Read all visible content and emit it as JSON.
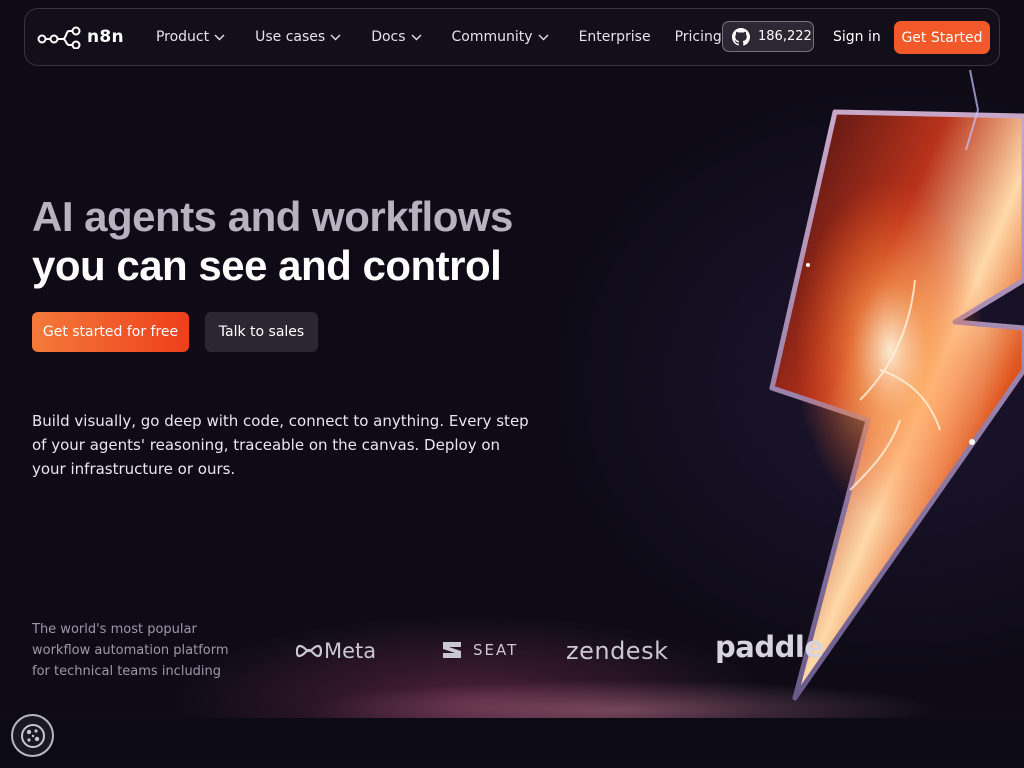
{
  "nav": {
    "logo_text": "n8n",
    "menu": [
      {
        "label": "Product",
        "has_dropdown": true
      },
      {
        "label": "Use cases",
        "has_dropdown": true
      },
      {
        "label": "Docs",
        "has_dropdown": true
      },
      {
        "label": "Community",
        "has_dropdown": true
      },
      {
        "label": "Enterprise",
        "has_dropdown": false
      },
      {
        "label": "Pricing",
        "has_dropdown": false
      }
    ],
    "github_stars": "186,222",
    "github_icon": "github-icon",
    "sign_in": "Sign in",
    "get_started": "Get Started"
  },
  "hero": {
    "title_line1": "AI agents and workflows",
    "title_line2": "you can see and control",
    "primary_cta": "Get started for free",
    "secondary_cta": "Talk to sales",
    "description": "Build visually, go deep with code, connect to anything. Every step of your agents' reasoning, traceable on the canvas. Deploy on your infrastructure or ours."
  },
  "trust": {
    "text": "The world's most popular workflow automation platform for technical teams including",
    "brands": [
      "Meta",
      "SEAT",
      "zendesk",
      "paddle"
    ]
  },
  "colors": {
    "accent": "#f2582a",
    "background": "#0e0b17",
    "button_secondary": "#2a2733"
  },
  "cookie_icon": "cookie-icon"
}
